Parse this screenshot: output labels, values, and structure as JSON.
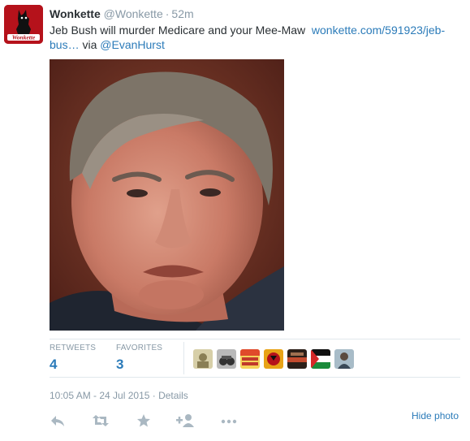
{
  "tweet": {
    "name": "Wonkette",
    "handle": "@Wonkette",
    "separator": "·",
    "time": "52m",
    "text_prefix": "Jeb Bush will murder Medicare and your Mee-Maw  ",
    "link": "wonkette.com/591923/jeb-bus…",
    "via_text": " via ",
    "via_handle": "@EvanHurst",
    "avatar_logo_text": "Wonkette"
  },
  "stats": {
    "retweets_label": "RETWEETS",
    "retweets_count": "4",
    "favorites_label": "FAVORITES",
    "favorites_count": "3",
    "favoriter_avatars": [
      "avatar-1",
      "avatar-2",
      "avatar-3",
      "avatar-4",
      "avatar-5",
      "avatar-6",
      "avatar-7"
    ]
  },
  "meta": {
    "timestamp": "10:05 AM - 24 Jul 2015",
    "separator": " · ",
    "details_link": "Details"
  },
  "actions": {
    "reply_icon": "reply-icon",
    "retweet_icon": "retweet-icon",
    "favorite_icon": "star-icon",
    "follow_icon": "follow-icon",
    "more_icon": "more-icon",
    "hide_photo": "Hide photo"
  },
  "colors": {
    "link": "#2b7bb9",
    "muted": "#8899a6",
    "text": "#292f33",
    "avatar_bg": "#b5121b"
  }
}
